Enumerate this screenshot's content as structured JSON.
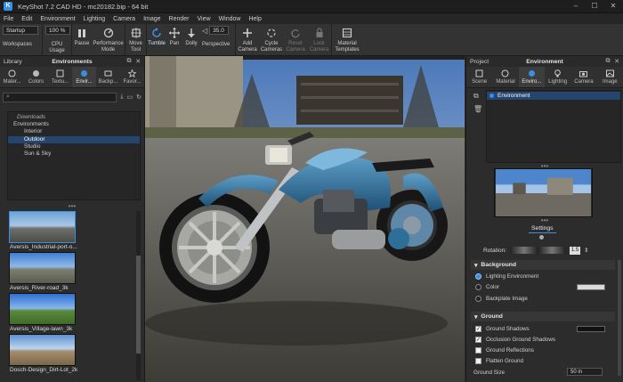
{
  "titlebar": {
    "title": "KeyShot 7.2 CAD HD  -  mc20182.bip  -  64 bit",
    "logo": "K"
  },
  "menu": [
    "File",
    "Edit",
    "Environment",
    "Lighting",
    "Camera",
    "Image",
    "Render",
    "View",
    "Window",
    "Help"
  ],
  "toolbar": {
    "workspace_value": "Startup",
    "cpu_value": "100 %",
    "fov_value": "35.0",
    "buttons": {
      "workspaces": "Workspaces",
      "cpu": "CPU Usage",
      "pause": "Pause",
      "perf": "Performance Mode",
      "move": "Move Tool",
      "tumble": "Tumble",
      "pan": "Pan",
      "dolly": "Dolly",
      "perspective": "Perspective",
      "add_camera": "Add Camera",
      "cycle": "Cycle Cameras",
      "reset": "Reset Camera",
      "lock": "Lock Camera",
      "material_templates": "Material Templates"
    }
  },
  "library": {
    "header_left": "Library",
    "header_center": "Environments",
    "tabs": [
      "Mater...",
      "Colors",
      "Textu...",
      "Envir...",
      "Backp...",
      "Favor..."
    ],
    "tree": [
      "Downloads",
      "Environments",
      "Interior",
      "Outdoor",
      "Studio",
      "Sun & Sky"
    ],
    "thumbs": [
      {
        "name": "Aversis_Industrial-port-o..."
      },
      {
        "name": "Aversis_River-road_3k"
      },
      {
        "name": "Aversis_Village-lawn_3k"
      },
      {
        "name": "Dosch-Design_Dirt-Lot_2k"
      }
    ]
  },
  "project": {
    "header_left": "Project",
    "header_center": "Environment",
    "tabs": [
      "Scene",
      "Material",
      "Enviro...",
      "Lighting",
      "Camera",
      "Image"
    ],
    "env_item": "Environment",
    "settings_tab": "Settings",
    "rotation_label": "Rotation:",
    "rotation_value": "1.5",
    "background": {
      "title": "Background",
      "options": [
        "Lighting Environment",
        "Color",
        "Backplate Image"
      ]
    },
    "ground": {
      "title": "Ground",
      "options": [
        "Ground Shadows",
        "Occlusion Ground Shadows",
        "Ground Reflections",
        "Flatten Ground"
      ],
      "checked": [
        true,
        true,
        false,
        false
      ],
      "size_label": "Ground Size",
      "size_value": "50 in"
    }
  },
  "colors": {
    "accent": "#3a8ee6",
    "selection": "#25456e",
    "panel": "#2c2c2c"
  }
}
